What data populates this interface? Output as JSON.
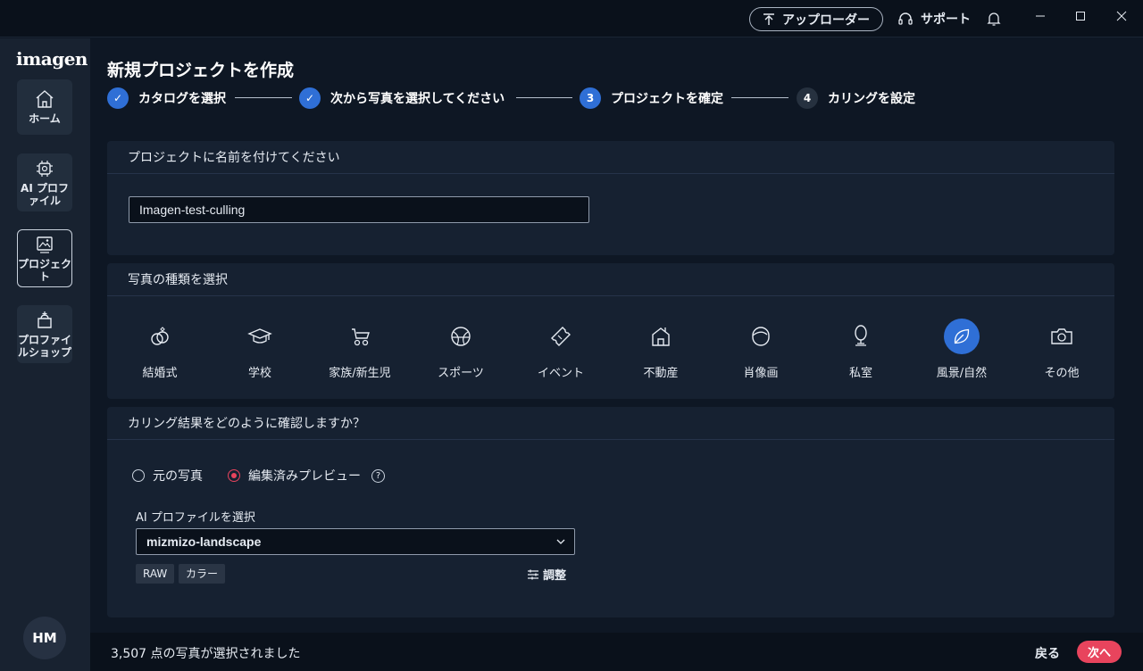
{
  "titlebar": {
    "uploader_label": "アップローダー",
    "support_label": "サポート"
  },
  "sidebar": {
    "logo": "imagen",
    "items": [
      {
        "label": "ホーム",
        "icon": "home-icon"
      },
      {
        "label": "AI プロファイル",
        "icon": "ai-chip-icon"
      },
      {
        "label": "プロジェクト",
        "icon": "image-gallery-icon"
      },
      {
        "label": "プロファイルショップ",
        "icon": "shop-icon"
      }
    ],
    "avatar_initials": "HM"
  },
  "main": {
    "title": "新規プロジェクトを作成",
    "steps": [
      {
        "label": "カタログを選択",
        "state": "done",
        "marker": "✓"
      },
      {
        "label": "次から写真を選択してください",
        "state": "done",
        "marker": "✓"
      },
      {
        "label": "プロジェクトを確定",
        "state": "active",
        "marker": "3"
      },
      {
        "label": "カリングを設定",
        "state": "todo",
        "marker": "4"
      }
    ]
  },
  "project_name": {
    "heading": "プロジェクトに名前を付けてください",
    "value": "Imagen-test-culling"
  },
  "photo_type": {
    "heading": "写真の種類を選択",
    "selected": "風景/自然",
    "items": [
      {
        "label": "結婚式",
        "icon": "rings-icon"
      },
      {
        "label": "学校",
        "icon": "graduation-cap-icon"
      },
      {
        "label": "家族/新生児",
        "icon": "stroller-icon"
      },
      {
        "label": "スポーツ",
        "icon": "ball-icon"
      },
      {
        "label": "イベント",
        "icon": "ticket-icon"
      },
      {
        "label": "不動産",
        "icon": "house-icon"
      },
      {
        "label": "肖像画",
        "icon": "portrait-icon"
      },
      {
        "label": "私室",
        "icon": "mirror-icon"
      },
      {
        "label": "風景/自然",
        "icon": "leaf-icon"
      },
      {
        "label": "その他",
        "icon": "camera-icon"
      }
    ]
  },
  "culling_review": {
    "heading": "カリング結果をどのように確認しますか？",
    "option_original": "元の写真",
    "option_edited": "編集済みプレビュー",
    "selected_option": "編集済みプレビュー",
    "ai_profile_label": "AI プロファイルを選択",
    "ai_profile_value": "mizmizo-landscape",
    "tags": [
      "RAW",
      "カラー"
    ],
    "adjust_label": "調整"
  },
  "footer": {
    "status": "3,507 点の写真が選択されました",
    "back_label": "戻る",
    "next_label": "次へ"
  },
  "colors": {
    "accent_blue": "#2f6fd6",
    "accent_red": "#e8445d",
    "background": "#0e1724",
    "card": "#162131"
  }
}
